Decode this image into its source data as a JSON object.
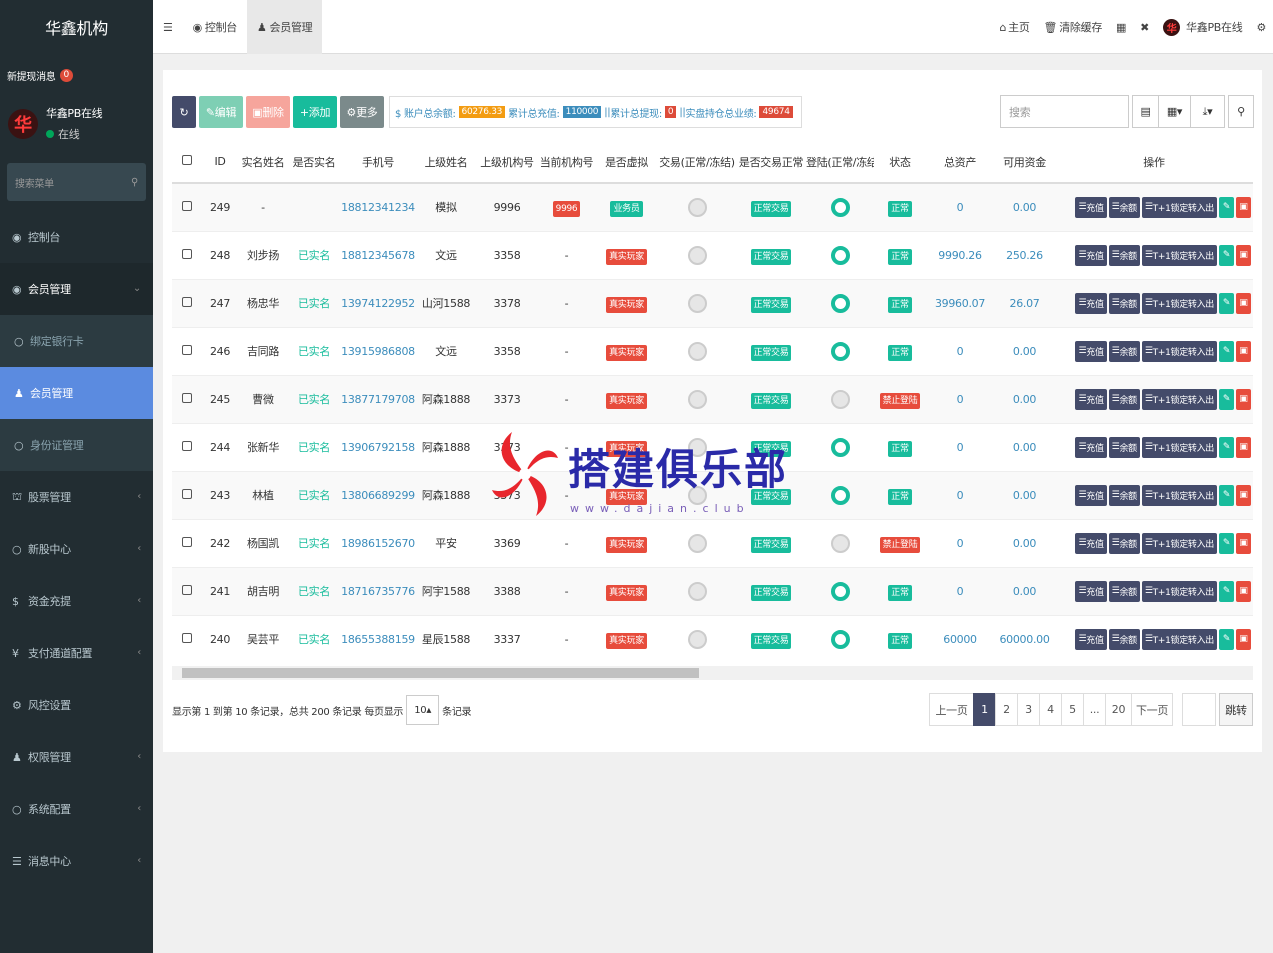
{
  "sidebar": {
    "brand": "华鑫机构",
    "notice": {
      "label": "新提现消息",
      "count": "0"
    },
    "user": {
      "avatar": "华",
      "name": "华鑫PB在线",
      "status": "在线"
    },
    "search_placeholder": "搜索菜单",
    "items": [
      {
        "label": "控制台",
        "icon": "dashboard-icon"
      },
      {
        "label": "会员管理",
        "icon": "user-icon"
      },
      {
        "label": "绑定银行卡",
        "icon": "circle-icon"
      },
      {
        "label": "会员管理",
        "icon": "user-icon"
      },
      {
        "label": "身份证管理",
        "icon": "circle-icon"
      },
      {
        "label": "股票管理",
        "icon": "bank-icon"
      },
      {
        "label": "新股中心",
        "icon": "circle-icon"
      },
      {
        "label": "资金充提",
        "icon": "dollar-icon"
      },
      {
        "label": "支付通道配置",
        "icon": "yen-icon"
      },
      {
        "label": "风控设置",
        "icon": "gear-icon"
      },
      {
        "label": "权限管理",
        "icon": "group-icon"
      },
      {
        "label": "系统配置",
        "icon": "circle-icon"
      },
      {
        "label": "消息中心",
        "icon": "list-icon"
      }
    ]
  },
  "topbar": {
    "tabs": [
      {
        "label": "控制台",
        "icon": "dashboard-icon"
      },
      {
        "label": "会员管理",
        "icon": "user-icon"
      }
    ],
    "right": {
      "home": "主页",
      "clear_cache": "清除缓存",
      "user": "华鑫PB在线"
    }
  },
  "toolbar": {
    "edit": "编辑",
    "delete": "删除",
    "add": "添加",
    "more": "更多",
    "stats": {
      "balance_label": "$ 账户总余额:",
      "balance": "60276.33",
      "recharge_label": "累计总充值:",
      "recharge": "110000",
      "withdraw_label": "累计总提现:",
      "withdraw": "0",
      "holding_label": "实盘持仓总业绩:",
      "holding": "49674"
    },
    "search_placeholder": "搜索"
  },
  "table": {
    "headers": [
      "ID",
      "实名姓名",
      "是否实名",
      "手机号",
      "上级姓名",
      "上级机构号",
      "当前机构号",
      "是否虚拟",
      "交易(正常/冻结)",
      "是否交易正常",
      "登陆(正常/冻结)",
      "状态",
      "总资产",
      "可用资金",
      "操作"
    ],
    "action_labels": {
      "recharge": "充值",
      "balance": "余额",
      "transfer": "T+1锁定转入出"
    },
    "rows": [
      {
        "id": "249",
        "name": "-",
        "verified": "",
        "phone": "18812341234",
        "parent": "模拟",
        "parent_org": "9996",
        "org": "9996",
        "virtual": "业务员",
        "virtual_color": "green",
        "trade_on": false,
        "trade_normal": "正常交易",
        "login_on": true,
        "status": "正常",
        "status_color": "green",
        "total": "0",
        "avail": "0.00"
      },
      {
        "id": "248",
        "name": "刘步扬",
        "verified": "已实名",
        "phone": "18812345678",
        "parent": "文远",
        "parent_org": "3358",
        "org": "-",
        "virtual": "真实玩家",
        "virtual_color": "red",
        "trade_on": false,
        "trade_normal": "正常交易",
        "login_on": true,
        "status": "正常",
        "status_color": "green",
        "total": "9990.26",
        "avail": "250.26"
      },
      {
        "id": "247",
        "name": "杨忠华",
        "verified": "已实名",
        "phone": "13974122952",
        "parent": "山河1588",
        "parent_org": "3378",
        "org": "-",
        "virtual": "真实玩家",
        "virtual_color": "red",
        "trade_on": false,
        "trade_normal": "正常交易",
        "login_on": true,
        "status": "正常",
        "status_color": "green",
        "total": "39960.07",
        "avail": "26.07"
      },
      {
        "id": "246",
        "name": "吉同路",
        "verified": "已实名",
        "phone": "13915986808",
        "parent": "文远",
        "parent_org": "3358",
        "org": "-",
        "virtual": "真实玩家",
        "virtual_color": "red",
        "trade_on": false,
        "trade_normal": "正常交易",
        "login_on": true,
        "status": "正常",
        "status_color": "green",
        "total": "0",
        "avail": "0.00"
      },
      {
        "id": "245",
        "name": "曹微",
        "verified": "已实名",
        "phone": "13877179708",
        "parent": "阿森1888",
        "parent_org": "3373",
        "org": "-",
        "virtual": "真实玩家",
        "virtual_color": "red",
        "trade_on": false,
        "trade_normal": "正常交易",
        "login_on": false,
        "status": "禁止登陆",
        "status_color": "red",
        "total": "0",
        "avail": "0.00"
      },
      {
        "id": "244",
        "name": "张新华",
        "verified": "已实名",
        "phone": "13906792158",
        "parent": "阿森1888",
        "parent_org": "3373",
        "org": "-",
        "virtual": "真实玩家",
        "virtual_color": "red",
        "trade_on": false,
        "trade_normal": "正常交易",
        "login_on": true,
        "status": "正常",
        "status_color": "green",
        "total": "0",
        "avail": "0.00"
      },
      {
        "id": "243",
        "name": "林植",
        "verified": "已实名",
        "phone": "13806689299",
        "parent": "阿森1888",
        "parent_org": "3373",
        "org": "-",
        "virtual": "真实玩家",
        "virtual_color": "red",
        "trade_on": false,
        "trade_normal": "正常交易",
        "login_on": true,
        "status": "正常",
        "status_color": "green",
        "total": "0",
        "avail": "0.00"
      },
      {
        "id": "242",
        "name": "杨国凯",
        "verified": "已实名",
        "phone": "18986152670",
        "parent": "平安",
        "parent_org": "3369",
        "org": "-",
        "virtual": "真实玩家",
        "virtual_color": "red",
        "trade_on": false,
        "trade_normal": "正常交易",
        "login_on": false,
        "status": "禁止登陆",
        "status_color": "red",
        "total": "0",
        "avail": "0.00"
      },
      {
        "id": "241",
        "name": "胡吉明",
        "verified": "已实名",
        "phone": "18716735776",
        "parent": "阿宇1588",
        "parent_org": "3388",
        "org": "-",
        "virtual": "真实玩家",
        "virtual_color": "red",
        "trade_on": false,
        "trade_normal": "正常交易",
        "login_on": true,
        "status": "正常",
        "status_color": "green",
        "total": "0",
        "avail": "0.00"
      },
      {
        "id": "240",
        "name": "吴芸平",
        "verified": "已实名",
        "phone": "18655388159",
        "parent": "星辰1588",
        "parent_org": "3337",
        "org": "-",
        "virtual": "真实玩家",
        "virtual_color": "red",
        "trade_on": false,
        "trade_normal": "正常交易",
        "login_on": true,
        "status": "正常",
        "status_color": "green",
        "total": "60000",
        "avail": "60000.00"
      }
    ]
  },
  "footer": {
    "summary": "显示第 1 到第 10 条记录，总共 200 条记录 每页显示",
    "page_size": "10",
    "suffix": "条记录"
  },
  "pager": {
    "prev": "上一页",
    "pages": [
      "1",
      "2",
      "3",
      "4",
      "5",
      "...",
      "20"
    ],
    "next": "下一页",
    "jump": "跳转"
  },
  "watermark": {
    "text": "搭建俱乐部",
    "sub": "www.dajian.club"
  }
}
